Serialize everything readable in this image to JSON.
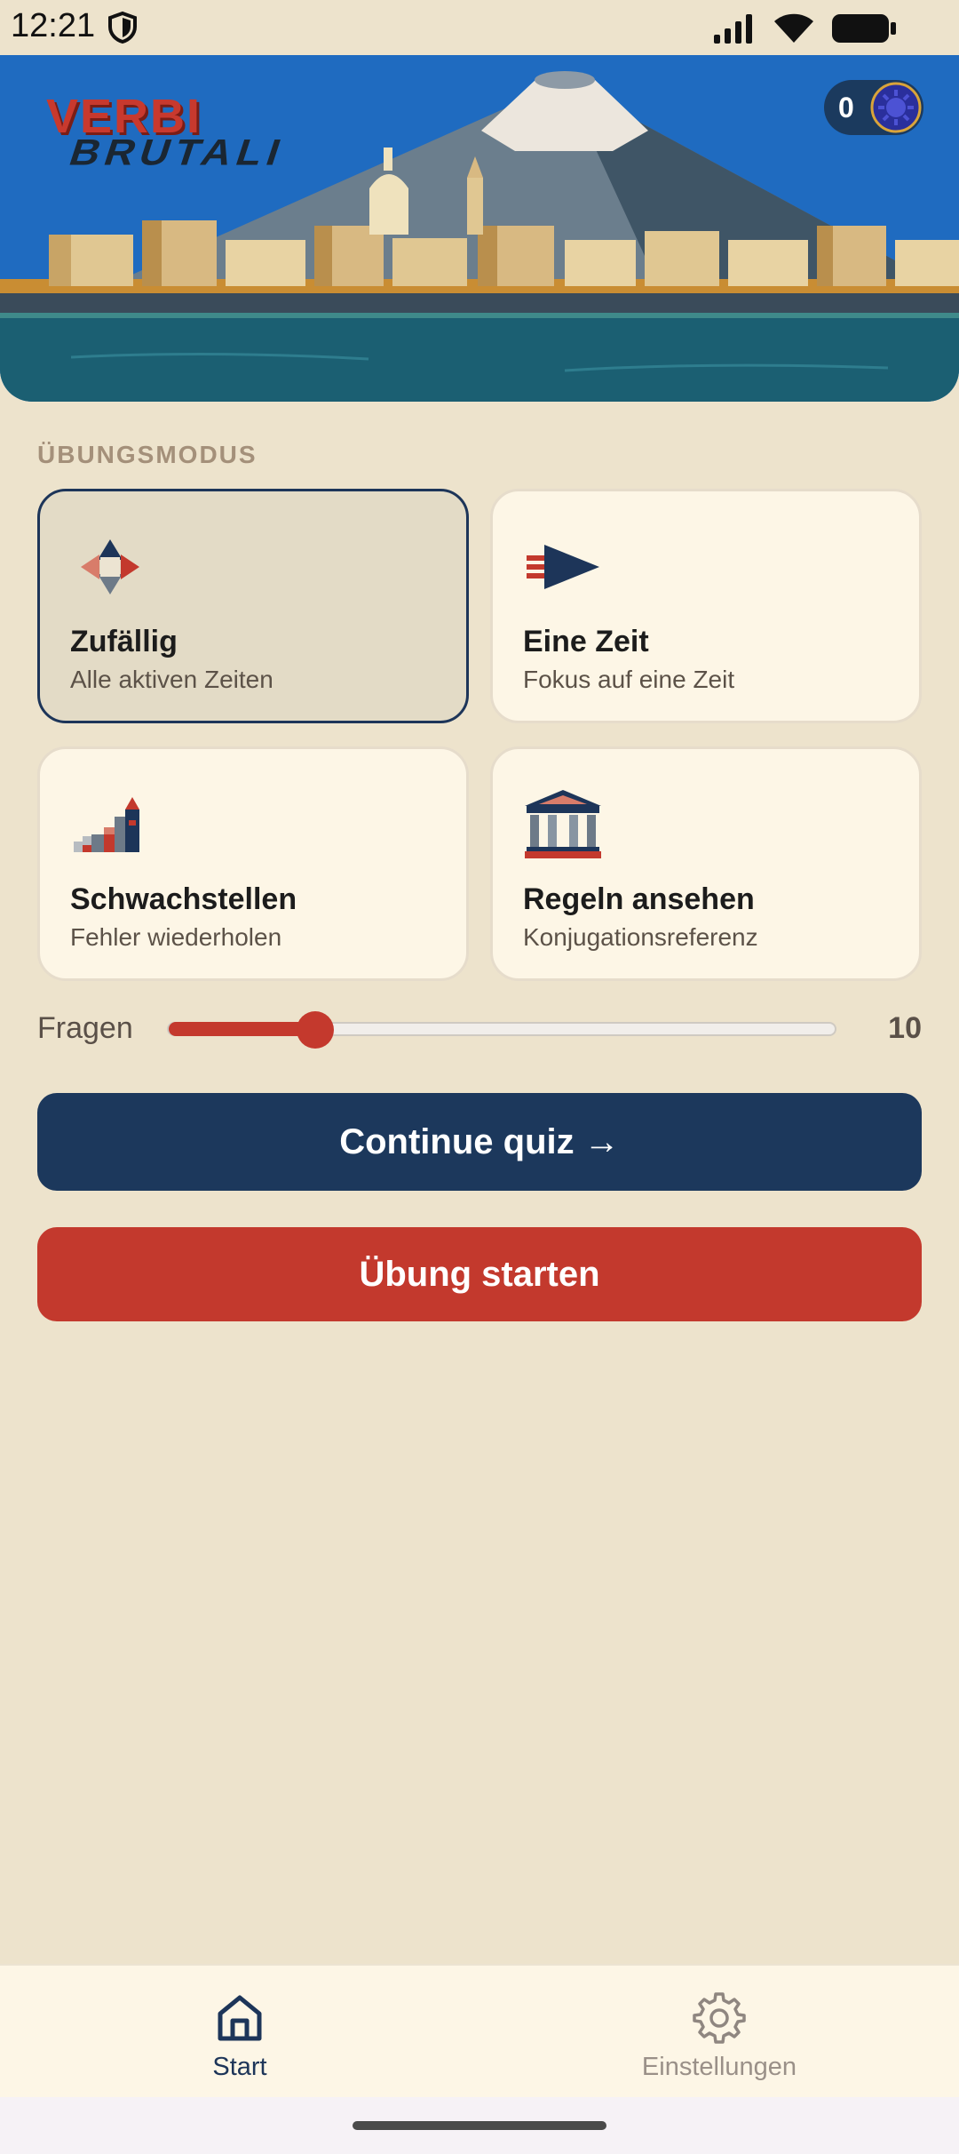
{
  "status_bar": {
    "time": "12:21",
    "icons": [
      "shield-icon",
      "signal-icon",
      "wifi-icon",
      "battery-icon"
    ]
  },
  "hero": {
    "logo_top": "VERBI",
    "logo_bottom": "BRUTALI",
    "coin_count": "0",
    "coin_icon": "sun-coin-icon"
  },
  "practice": {
    "section_label": "ÜBUNGSMODUS",
    "modes": [
      {
        "title": "Zufällig",
        "subtitle": "Alle aktiven Zeiten",
        "icon": "compass-icon",
        "selected": true
      },
      {
        "title": "Eine Zeit",
        "subtitle": "Fokus auf eine Zeit",
        "icon": "arrow-flag-icon",
        "selected": false
      },
      {
        "title": "Schwachstellen",
        "subtitle": "Fehler wiederholen",
        "icon": "stairs-tower-icon",
        "selected": false
      },
      {
        "title": "Regeln ansehen",
        "subtitle": "Konjugationsreferenz",
        "icon": "temple-icon",
        "selected": false
      }
    ]
  },
  "questions": {
    "label": "Fragen",
    "value": "10",
    "slider_fraction": 0.22
  },
  "actions": {
    "continue_label": "Continue quiz →",
    "start_label": "Übung starten"
  },
  "nav": {
    "items": [
      {
        "label": "Start",
        "icon": "home-icon",
        "active": true
      },
      {
        "label": "Einstellungen",
        "icon": "gear-icon",
        "active": false
      }
    ]
  },
  "colors": {
    "background": "#ede3cc",
    "navy": "#1c385c",
    "red": "#c3392d",
    "card": "#fdf6e6",
    "card_selected": "#e3dbc6"
  }
}
